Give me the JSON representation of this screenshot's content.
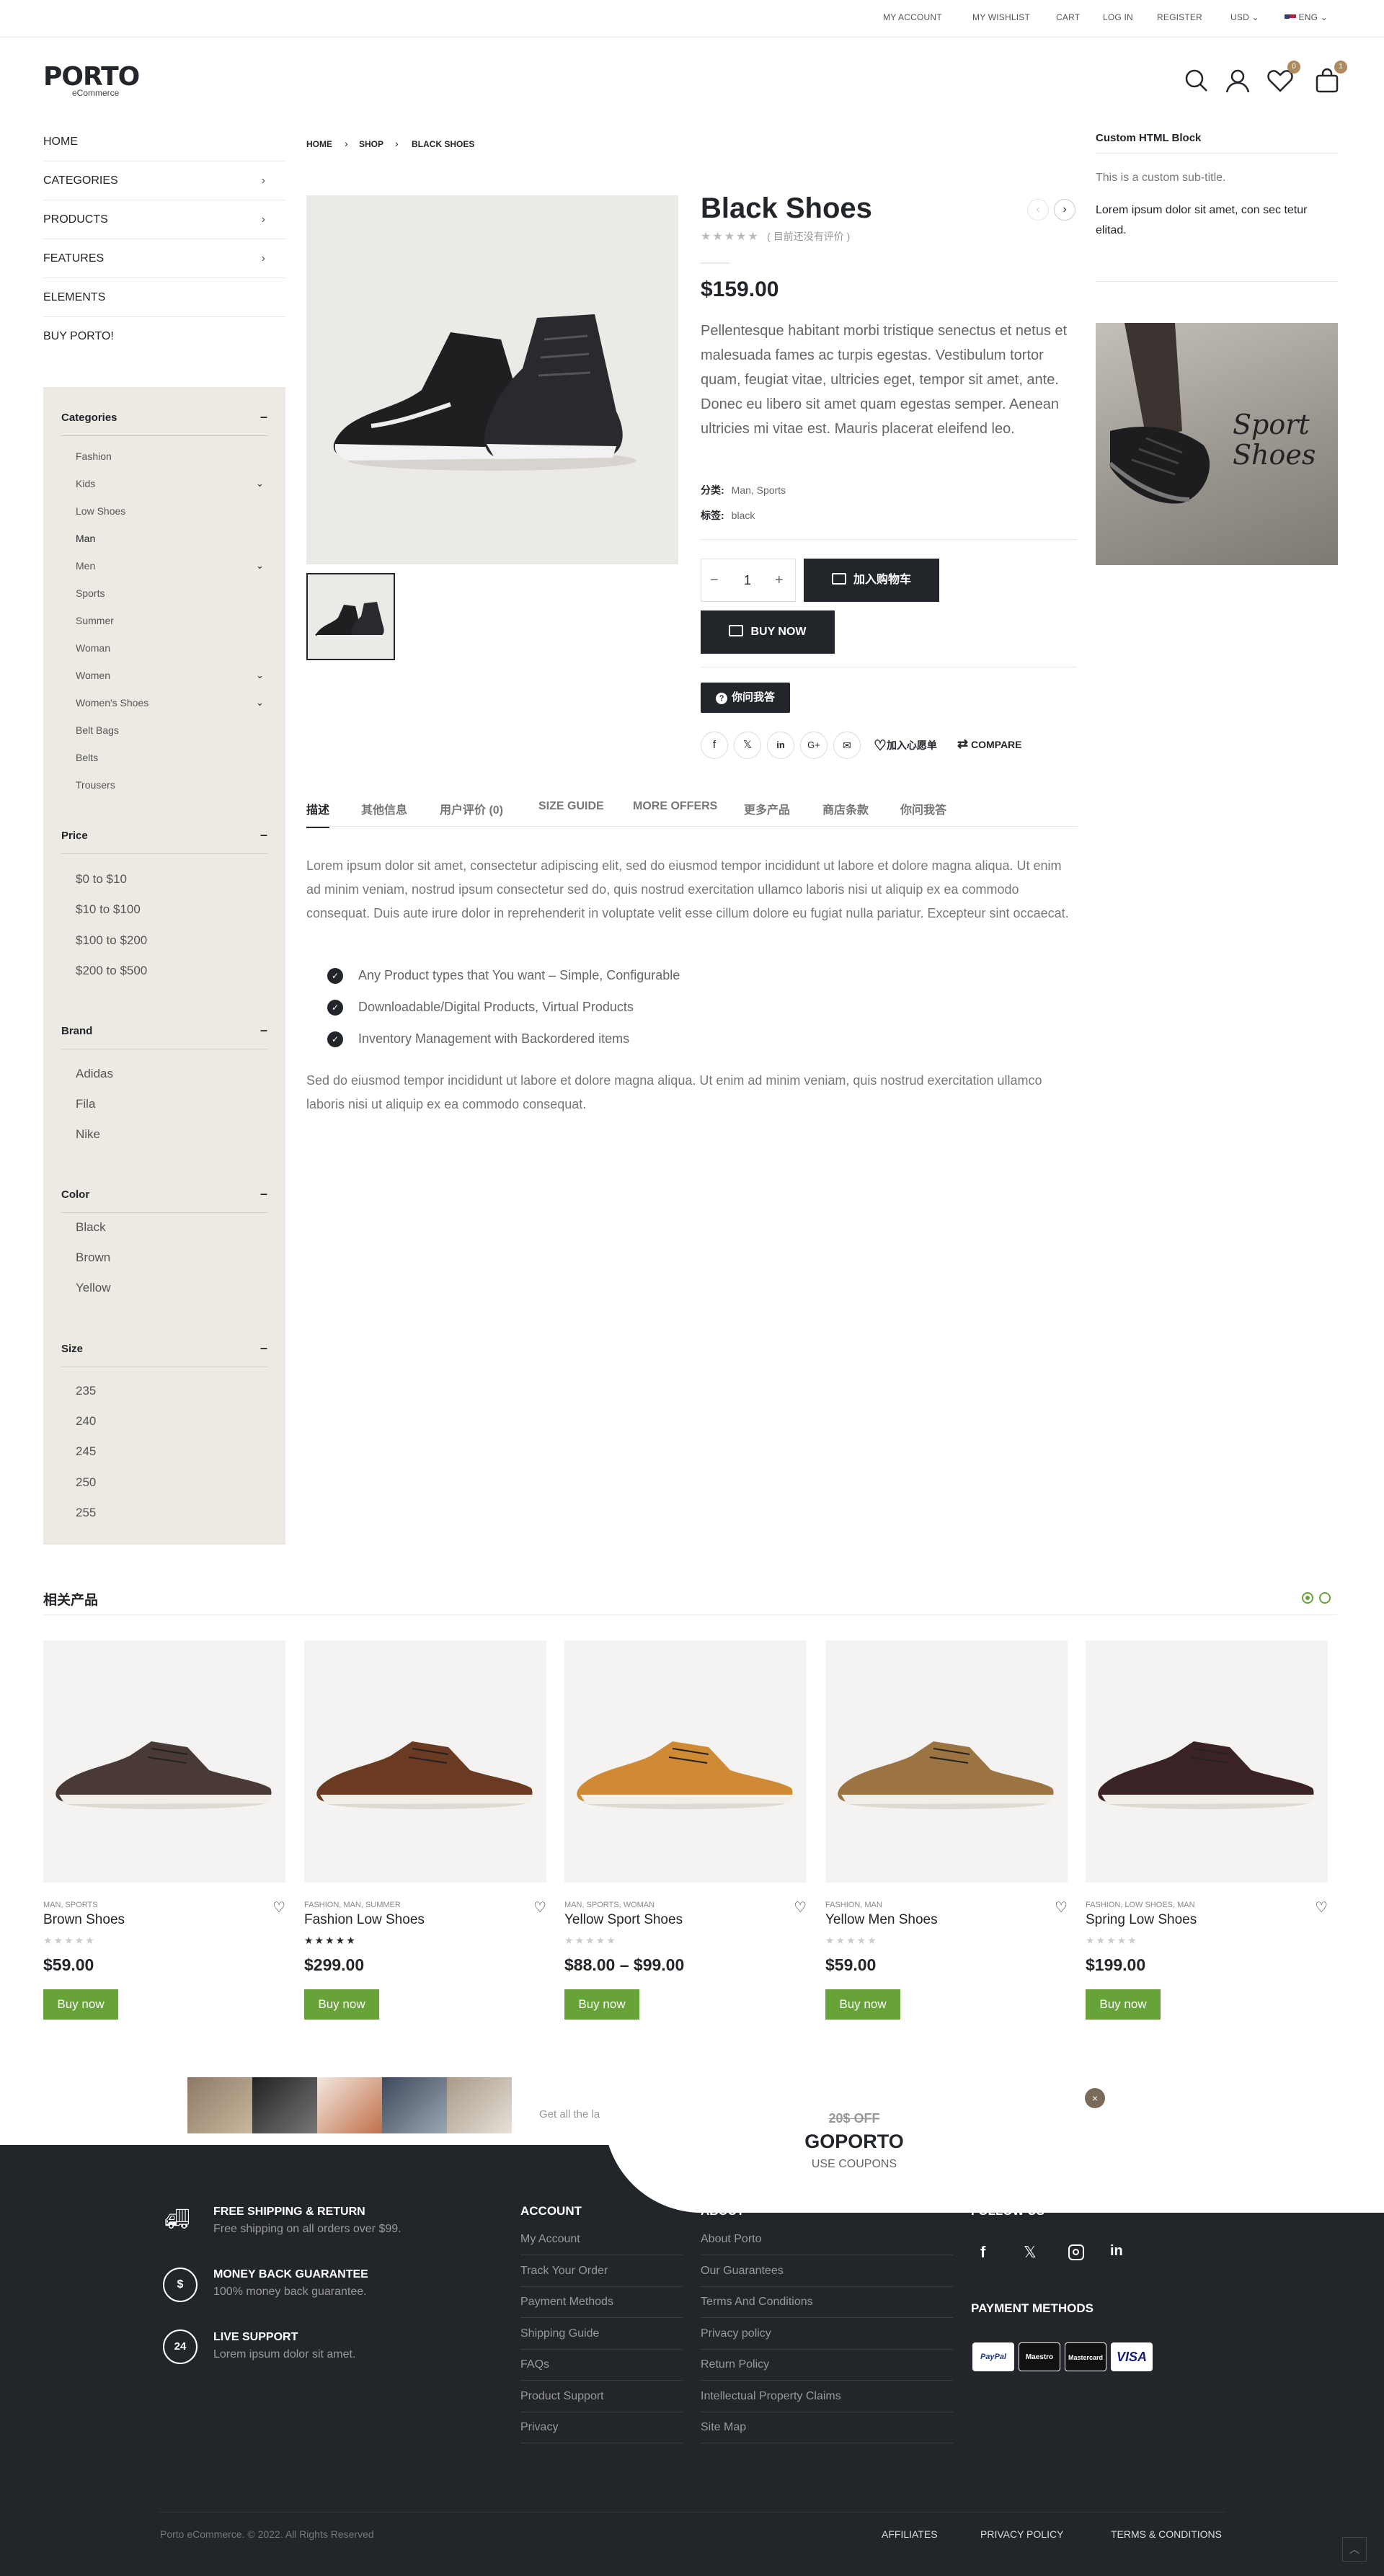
{
  "topbar": {
    "links": [
      "MY ACCOUNT",
      "MY WISHLIST",
      "CART",
      "LOG IN",
      "REGISTER"
    ],
    "currency": "USD",
    "language": "ENG"
  },
  "header": {
    "logo": "PORTO",
    "logo_sub": "eCommerce",
    "wishlist_count": "0",
    "cart_count": "1"
  },
  "nav": {
    "items": [
      {
        "label": "HOME"
      },
      {
        "label": "CATEGORIES",
        "has_children": true
      },
      {
        "label": "PRODUCTS",
        "has_children": true
      },
      {
        "label": "FEATURES",
        "has_children": true
      },
      {
        "label": "ELEMENTS"
      },
      {
        "label": "BUY PORTO!"
      }
    ]
  },
  "sidebar": {
    "categories_title": "Categories",
    "categories": [
      "Fashion",
      "Kids",
      "Low Shoes",
      "Man",
      "Men",
      "Sports",
      "Summer",
      "Woman",
      "Women",
      "Women's Shoes",
      "Belt Bags",
      "Belts",
      "Trousers"
    ],
    "price_title": "Price",
    "prices": [
      "$0 to $10",
      "$10 to $100",
      "$100 to $200",
      "$200 to $500"
    ],
    "brand_title": "Brand",
    "brands": [
      "Adidas",
      "Fila",
      "Nike"
    ],
    "color_title": "Color",
    "colors": [
      "Black",
      "Brown",
      "Yellow"
    ],
    "size_title": "Size",
    "sizes": [
      "235",
      "240",
      "245",
      "250",
      "255"
    ]
  },
  "breadcrumb": [
    "HOME",
    "SHOP",
    "BLACK SHOES"
  ],
  "product": {
    "title": "Black Shoes",
    "rating_text": "( 目前还没有评价 )",
    "price": "$159.00",
    "description": "Pellentesque habitant morbi tristique senectus et netus et malesuada fames ac turpis egestas. Vestibulum tortor quam, feugiat vitae, ultricies eget, tempor sit amet, ante. Donec eu libero sit amet quam egestas semper. Aenean ultricies mi vitae est. Mauris placerat eleifend leo.",
    "category_label": "分类:",
    "categories": "Man, Sports",
    "tag_label": "标签:",
    "tags": "black",
    "qty": "1",
    "add_to_cart": "加入购物车",
    "buy_now": "BUY NOW",
    "ask_button": "你问我答",
    "wishlist": "加入心愿单",
    "compare": "COMPARE"
  },
  "tabs": [
    "描述",
    "其他信息",
    "用户评价 (0)",
    "SIZE GUIDE",
    "MORE OFFERS",
    "更多产品",
    "商店条款",
    "你问我答"
  ],
  "tab_content": {
    "para1": "Lorem ipsum dolor sit amet, consectetur adipiscing elit, sed do eiusmod tempor incididunt ut labore et dolore magna aliqua. Ut enim ad minim veniam, nostrud ipsum consectetur sed do, quis nostrud exercitation ullamco laboris nisi ut aliquip ex ea commodo consequat. Duis aute irure dolor in reprehenderit in voluptate velit esse cillum dolore eu fugiat nulla pariatur. Excepteur sint occaecat.",
    "bullets": [
      "Any Product types that You want – Simple, Configurable",
      "Downloadable/Digital Products, Virtual Products",
      "Inventory Management with Backordered items"
    ],
    "para2": "Sed do eiusmod tempor incididunt ut labore et dolore magna aliqua. Ut enim ad minim veniam, quis nostrud exercitation ullamco laboris nisi ut aliquip ex ea commodo consequat."
  },
  "right_col": {
    "title": "Custom HTML Block",
    "subtitle": "This is a custom sub-title.",
    "text": "Lorem ipsum dolor sit amet, con sec tetur elitad.",
    "banner_text": "Sport Shoes"
  },
  "related": {
    "title": "相关产品",
    "products": [
      {
        "cats": "MAN, SPORTS",
        "name": "Brown Shoes",
        "price": "$59.00",
        "rated": false,
        "color": "#4a3a35"
      },
      {
        "cats": "FASHION, MAN, SUMMER",
        "name": "Fashion Low Shoes",
        "price": "$299.00",
        "rated": true,
        "color": "#6b3a22"
      },
      {
        "cats": "MAN, SPORTS, WOMAN",
        "name": "Yellow Sport Shoes",
        "price": "$88.00 – $99.00",
        "rated": false,
        "color": "#d08a34"
      },
      {
        "cats": "FASHION, MAN",
        "name": "Yellow Men Shoes",
        "price": "$59.00",
        "rated": false,
        "color": "#9b7442"
      },
      {
        "cats": "FASHION, LOW SHOES, MAN",
        "name": "Spring Low Shoes",
        "price": "$199.00",
        "rated": false,
        "color": "#3b2225"
      }
    ],
    "buy_label": "Buy now"
  },
  "promo": {
    "text": "Get all the la",
    "off": "20$ OFF",
    "code": "GOPORTO",
    "use": "USE COUPONS"
  },
  "footer": {
    "features": [
      {
        "icon": "truck-icon",
        "title": "FREE SHIPPING & RETURN",
        "sub": "Free shipping on all orders over $99."
      },
      {
        "icon": "dollar-icon",
        "title": "MONEY BACK GUARANTEE",
        "sub": "100% money back guarantee."
      },
      {
        "icon": "support-24-icon",
        "title": "LIVE SUPPORT",
        "sub": "Lorem ipsum dolor sit amet."
      }
    ],
    "account_title": "ACCOUNT",
    "account_links": [
      "My Account",
      "Track Your Order",
      "Payment Methods",
      "Shipping Guide",
      "FAQs",
      "Product Support",
      "Privacy"
    ],
    "about_title": "ABOUT",
    "about_links": [
      "About Porto",
      "Our Guarantees",
      "Terms And Conditions",
      "Privacy policy",
      "Return Policy",
      "Intellectual Property Claims",
      "Site Map"
    ],
    "follow_title": "FOLLOW US",
    "payment_title": "PAYMENT METHODS",
    "payments": [
      "PayPal",
      "Maestro",
      "Mastercard",
      "VISA"
    ],
    "copyright": "Porto eCommerce. © 2022. All Rights Reserved",
    "bottom_links": [
      "AFFILIATES",
      "PRIVACY POLICY",
      "TERMS & CONDITIONS"
    ]
  }
}
